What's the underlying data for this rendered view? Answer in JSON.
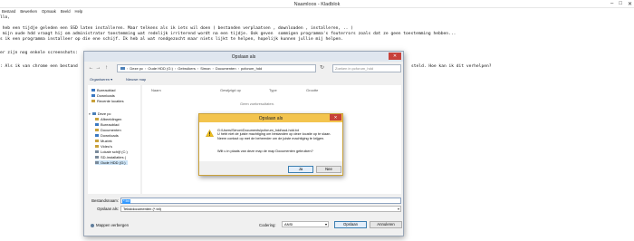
{
  "notepad": {
    "title": "Naamloos - Kladblok",
    "menu": [
      "Bestand",
      "Bewerken",
      "Opmaak",
      "Beeld",
      "Help"
    ],
    "lines": [
      "llo,",
      "",
      " heb een tijdje geleden een SSD laten installeren. Maar telkens als ik iets wil doen ( bestanden verplaatsen , downloaden , installeren, .. )",
      " mijn oude hdd vraagt hij om administrator toestemming wat redelijk irriterend wordt na een tijdje. Ook geven  sommigen programma's fouterrors zoals dat ze geen toestemming hebben...",
      "s ik een programma installeer op die ene schijf. Ik heb al wat rondgezocht maar niets lijkt te helpen, hopelijk kunnen jullie mij helpen.",
      "",
      "er zijn nog enkele screenshots:",
      "",
      ": Als ik van chrome een bestand"
    ],
    "line_right": "steld. Hoe kan ik dit verhelpen?"
  },
  "save_dialog": {
    "title": "Opslaan als",
    "close": "✕",
    "path": [
      "Deze pc",
      "Oude HDD (G:)",
      "Gebruikers",
      "Simon",
      "Documenten",
      "pcforum_hdd"
    ],
    "search_placeholder": "Zoeken in pcforum_hdd",
    "toolbar": {
      "organize": "Organiseren ▾",
      "new_folder": "Nieuwe map"
    },
    "sidebar": [
      "Bureaublad",
      "Downloads",
      "Recente locaties",
      "",
      "Deze pc",
      "Afbeeldingen",
      "Bureaublad",
      "Documenten",
      "Downloads",
      "Muziek",
      "Video's",
      "Lokale schijf (C:)",
      "SD-installaties (",
      "Oude HDD (G:)"
    ],
    "columns": [
      "Naam",
      "Gewijzigd op",
      "Type",
      "Grootte"
    ],
    "empty_text": "Geen zoekresultaten.",
    "filename_label": "Bestandsnaam:",
    "filename_value": "*.txt",
    "filetype_label": "Opslaan als:",
    "filetype_value": "Tekstdocumenten (*.txt)",
    "hide_folders": "Mappen verbergen",
    "encoding_label": "Codering:",
    "encoding_value": "ANSI",
    "save_button": "Opslaan",
    "cancel_button": "Annuleren"
  },
  "error_dialog": {
    "title": "Opslaan als",
    "close": "✕",
    "message_lines": [
      "G:\\Users\\Simon\\Documents\\pcforum_hdd\\ssd-hdd.txt",
      "U hebt niet de juiste machtiging om bestanden op deze locatie op te slaan.",
      "Neem contact op met de beheerder om de juiste machtiging te krijgen."
    ],
    "question": "Wilt u in plaats van deze map de map Documenten gebruiken?",
    "yes": "Ja",
    "no": "Nee"
  },
  "colors": {
    "warning_yellow": "#f3c44e",
    "accent_blue": "#3399ff",
    "close_red": "#c7413a"
  }
}
